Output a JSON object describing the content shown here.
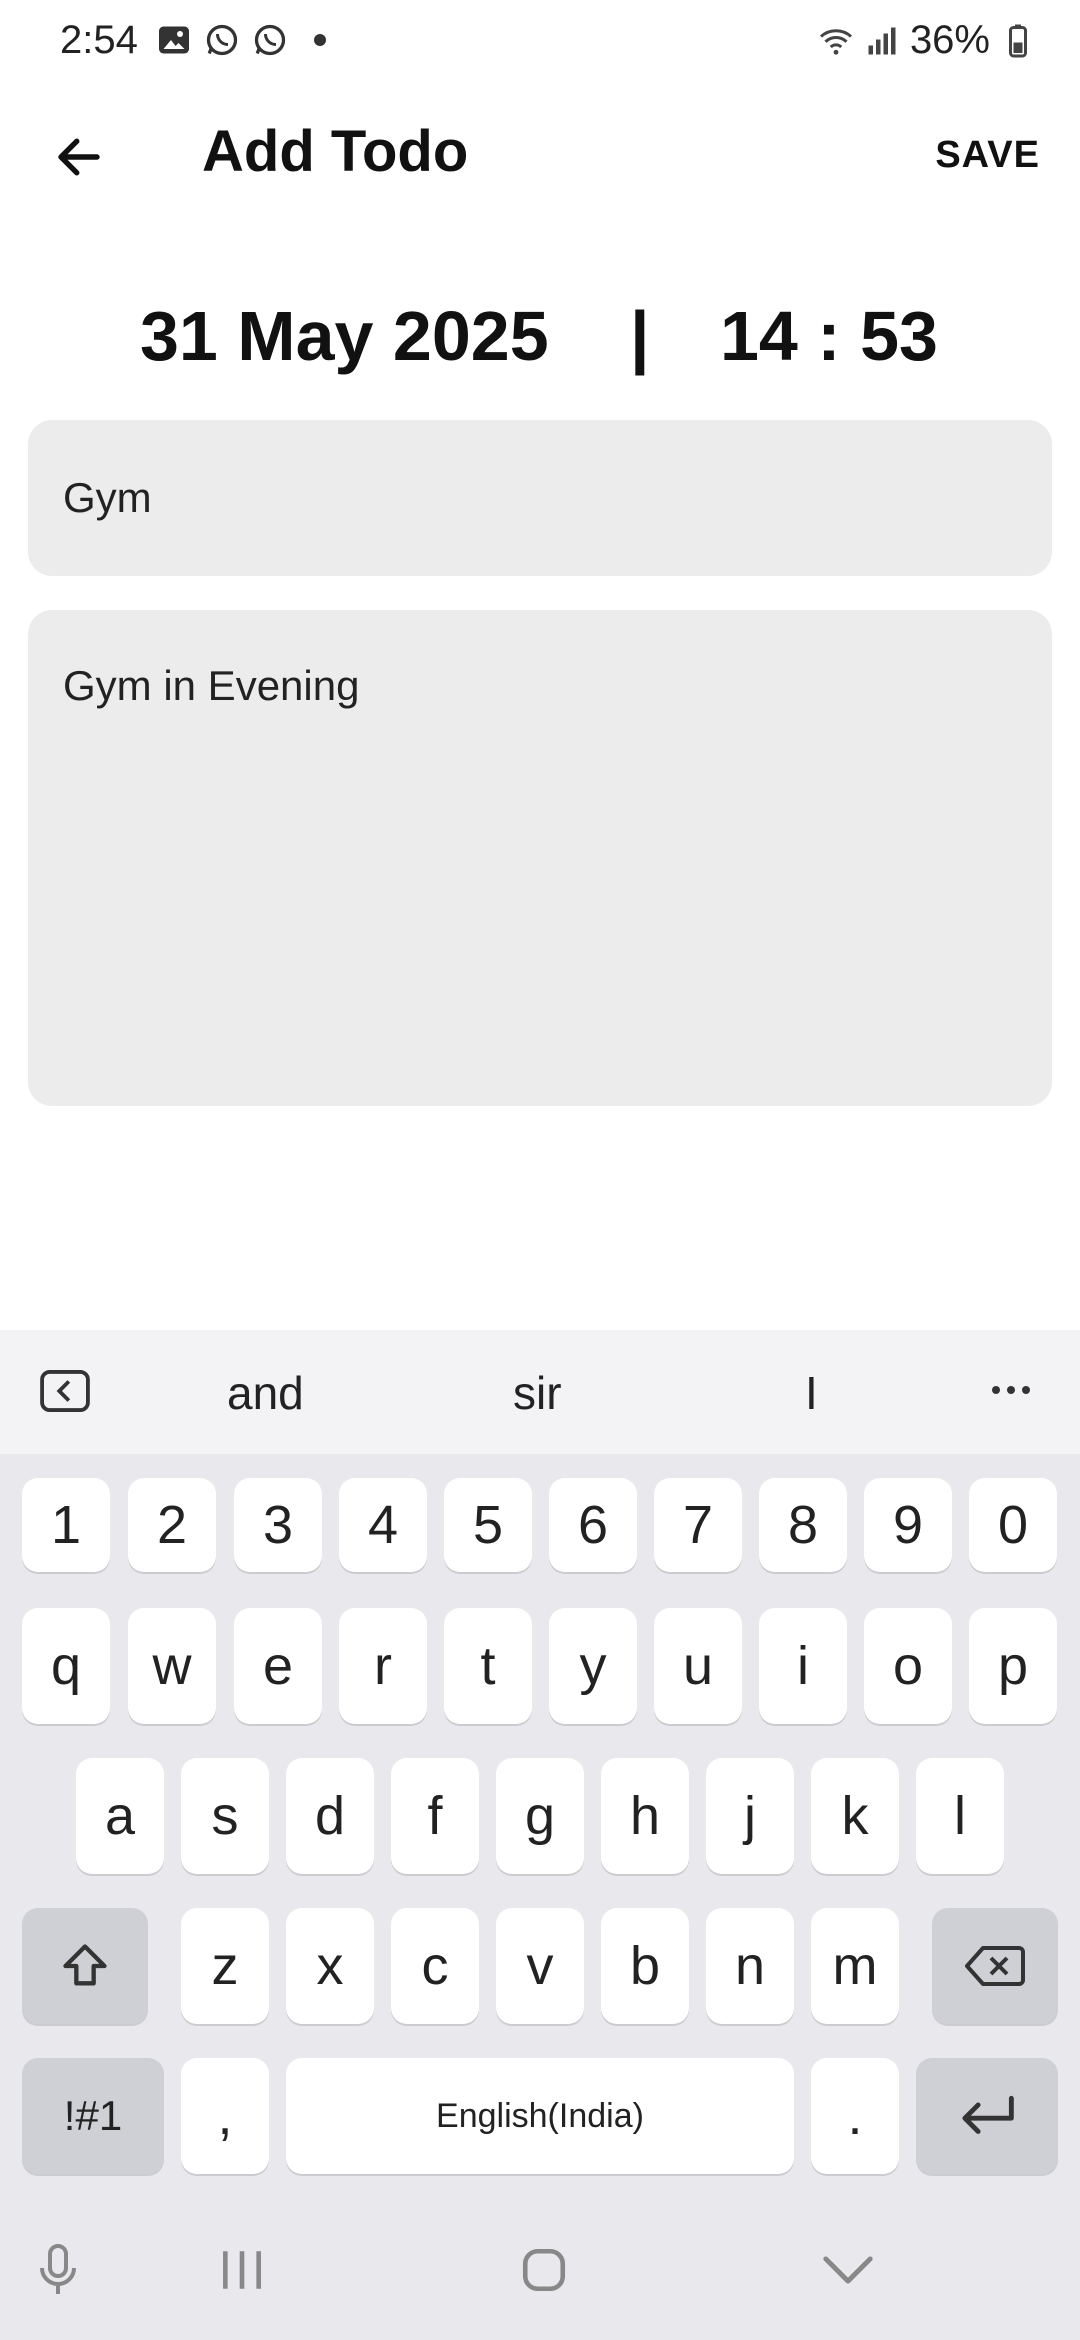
{
  "status_bar": {
    "time": "2:54",
    "battery": "36%",
    "icons_left": [
      "gallery-icon",
      "whatsapp-icon",
      "whatsapp-icon",
      "dot-icon"
    ],
    "icons_right": [
      "wifi-icon",
      "signal-icon",
      "battery-icon"
    ]
  },
  "app_bar": {
    "title": "Add Todo",
    "save_label": "SAVE"
  },
  "datetime": {
    "date": "31 May 2025",
    "separator": "|",
    "time": "14 : 53"
  },
  "form": {
    "title_value": "Gym",
    "description_value": "Gym in Evening"
  },
  "keyboard": {
    "suggestions": [
      "and",
      "sir",
      "I"
    ],
    "row_numbers": [
      "1",
      "2",
      "3",
      "4",
      "5",
      "6",
      "7",
      "8",
      "9",
      "0"
    ],
    "row1": [
      "q",
      "w",
      "e",
      "r",
      "t",
      "y",
      "u",
      "i",
      "o",
      "p"
    ],
    "row2": [
      "a",
      "s",
      "d",
      "f",
      "g",
      "h",
      "j",
      "k",
      "l"
    ],
    "row3": [
      "z",
      "x",
      "c",
      "v",
      "b",
      "n",
      "m"
    ],
    "symbols_label": "!#1",
    "comma_label": ",",
    "space_label": "English(India)",
    "period_label": "."
  },
  "colors": {
    "field_bg": "#ececec",
    "keyboard_bg": "#e8e8ed",
    "key_bg": "#ffffff",
    "function_key_bg": "#cfd0d6"
  }
}
